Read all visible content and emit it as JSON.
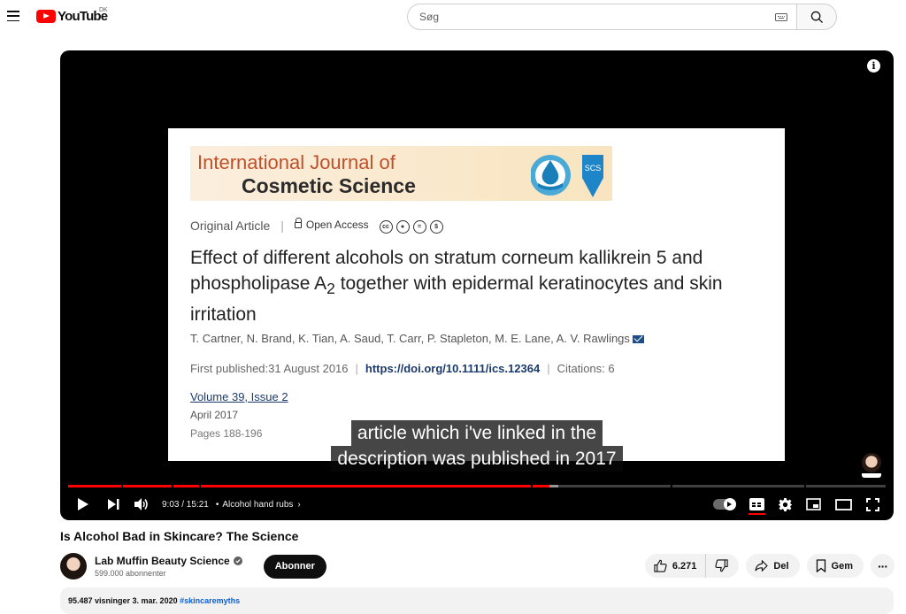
{
  "header": {
    "logo_text": "YouTube",
    "country_code": "DK",
    "search_placeholder": "Søg"
  },
  "slide": {
    "journal_line1": "International Journal of",
    "journal_line2": "Cosmetic Science",
    "journal_logo_text": "SCS",
    "article_type": "Original Article",
    "access": "Open Access",
    "title_part1": "Effect of different alcohols on stratum corneum kallikrein 5 and phospholipase A",
    "title_subscript": "2",
    "title_part2": " together with epidermal keratinocytes and skin irritation",
    "authors": "T. Cartner,  N. Brand,  K. Tian,  A. Saud,  T. Carr,  P. Stapleton,  M. E. Lane,  A. V. Rawlings",
    "first_published": "First published:31 August 2016",
    "doi": "https://doi.org/10.1111/ics.12364",
    "citations": "Citations: 6",
    "volume": "Volume 39, Issue 2",
    "date": "April 2017",
    "pages": "Pages 188-196"
  },
  "captions": {
    "line1": "article which i've linked in the",
    "line2": "description was published in 2017"
  },
  "player": {
    "current_time": "9:03",
    "duration": "15:21",
    "time_display": "9:03 / 15:21",
    "chapter": "Alcohol hand rubs",
    "progress_fraction": 0.589,
    "buffer_fraction": 0.6,
    "chapter_marks": [
      0.065,
      0.127,
      0.16,
      0.566,
      0.737,
      0.9
    ]
  },
  "video": {
    "title": "Is Alcohol Bad in Skincare? The Science",
    "channel_name": "Lab Muffin Beauty Science",
    "subscribers": "599.000 abonnenter",
    "subscribe_label": "Abonner",
    "likes": "6.271",
    "share_label": "Del",
    "save_label": "Gem",
    "views_date": "95.487 visninger  3. mar. 2020  ",
    "hashtag": "#skincaremyths"
  },
  "colors": {
    "brand_red": "#ff0000",
    "player_bg": "#000000",
    "link_blue": "#065fd4"
  }
}
